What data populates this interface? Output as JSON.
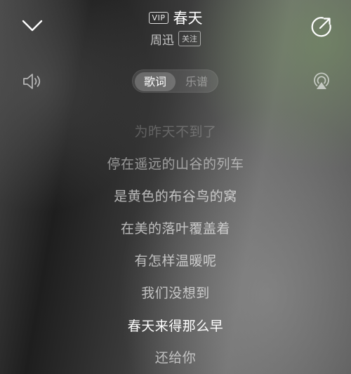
{
  "header": {
    "vip_badge": "VIP",
    "song_title": "春天",
    "artist": "周迅",
    "follow_label": "关注",
    "collapse_icon": "chevron-down-icon",
    "share_icon": "share-icon"
  },
  "controls": {
    "volume_icon": "volume-icon",
    "airplay_icon": "airplay-icon",
    "tabs": [
      {
        "label": "歌词",
        "active": true
      },
      {
        "label": "乐谱",
        "active": false
      }
    ]
  },
  "lyrics": {
    "lines": [
      "为昨天不到了",
      "停在遥远的山谷的列车",
      "是黄色的布谷鸟的窝",
      "在美的落叶覆盖着",
      "有怎样温暖呢",
      "我们没想到",
      "春天来得那么早",
      "还给你"
    ],
    "current_index": 6
  },
  "colors": {
    "highlight": "#ffffff",
    "dimmed": "#a6a6a6"
  }
}
